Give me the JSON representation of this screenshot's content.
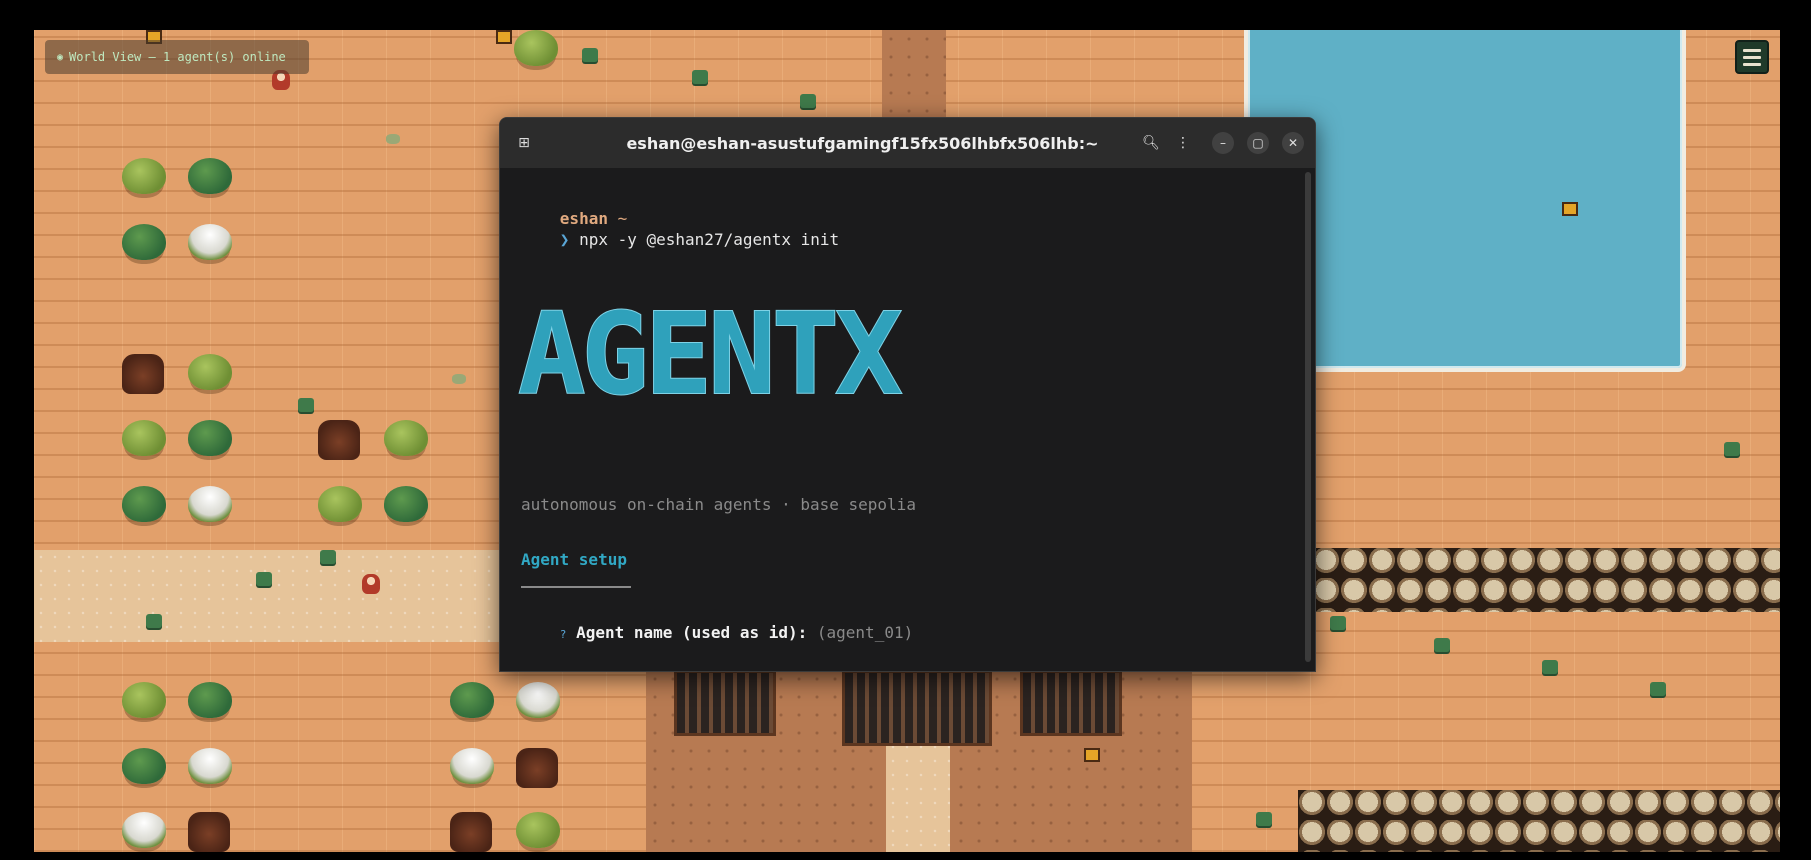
{
  "hud": {
    "eye_icon": "eye-icon",
    "status_text": "World View — 1 agent(s) online"
  },
  "menu": {
    "icon": "hamburger-menu-icon"
  },
  "terminal": {
    "title": "eshan@eshan-asustufgamingf15fx506lhbfx506lhb:~",
    "icons": [
      "new-tab-icon",
      "search-icon",
      "kebab-menu-icon",
      "minimize-icon",
      "restore-icon",
      "close-icon"
    ],
    "prompt_user": "eshan",
    "prompt_dir": "~",
    "prompt_arrow": "❯",
    "command": "npx -y @eshan27/agentx init",
    "banner": "AGENTX",
    "tagline": "autonomous on-chain agents · base sepolia",
    "section_title": "Agent setup",
    "question_marker": "?",
    "question_label": "Agent name (used as id):",
    "question_default": "(agent_01)"
  },
  "colors": {
    "accent": "#31a8c4",
    "sand": "#e2a06b",
    "water": "#5fb0c6",
    "terminal_bg": "#1b1b1c"
  }
}
